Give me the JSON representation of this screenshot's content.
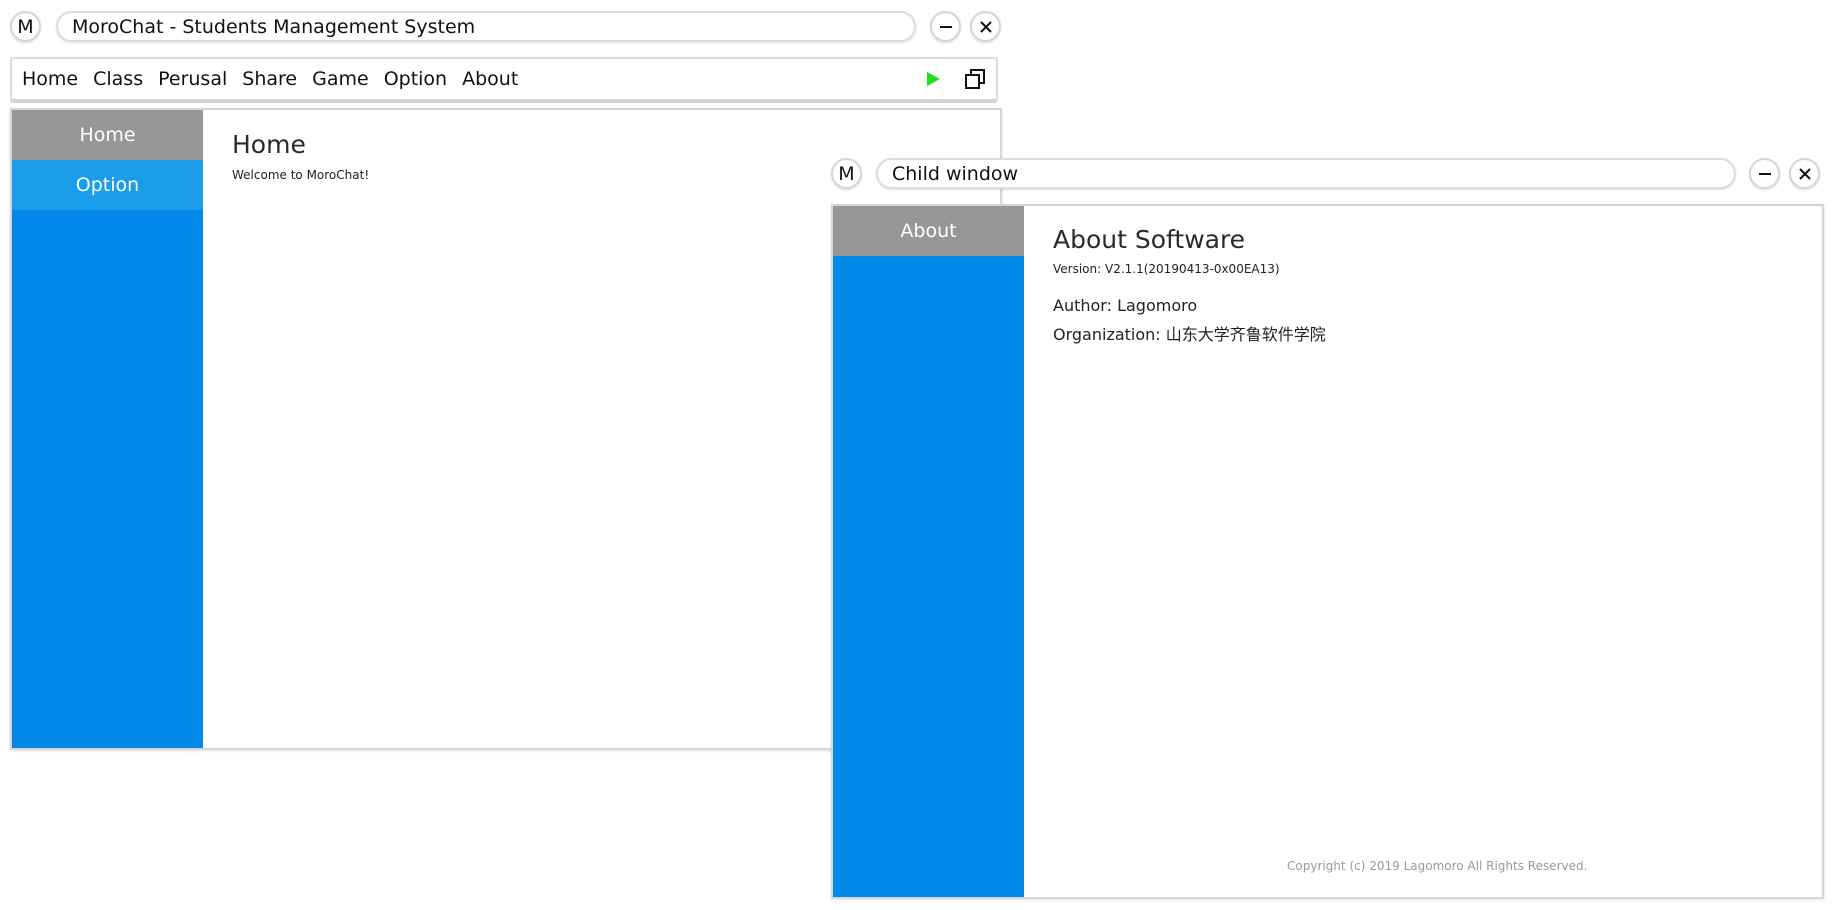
{
  "main_window": {
    "logo": "M",
    "title": "MoroChat - Students Management System",
    "menu": [
      "Home",
      "Class",
      "Perusal",
      "Share",
      "Game",
      "Option",
      "About"
    ],
    "toolbar_icons": [
      "play-icon",
      "restore-window-icon"
    ],
    "sidebar": [
      "Home",
      "Option"
    ],
    "content": {
      "title": "Home",
      "subtitle": "Welcome to MoroChat!"
    }
  },
  "child_window": {
    "logo": "M",
    "title": "Child window",
    "sidebar": [
      "About"
    ],
    "content": {
      "title": "About Software",
      "version": "Version: V2.1.1(20190413-0x00EA13)",
      "author": "Author: Lagomoro",
      "organization": "Organization: 山东大学齐鲁软件学院",
      "copyright": "Copyright (c) 2019 Lagomoro All Rights Reserved."
    }
  },
  "colors": {
    "sidebar_blue": "#0288e8",
    "sidebar_active": "#979797",
    "sidebar_hover": "#1a9deb",
    "play_green": "#22dd22"
  }
}
